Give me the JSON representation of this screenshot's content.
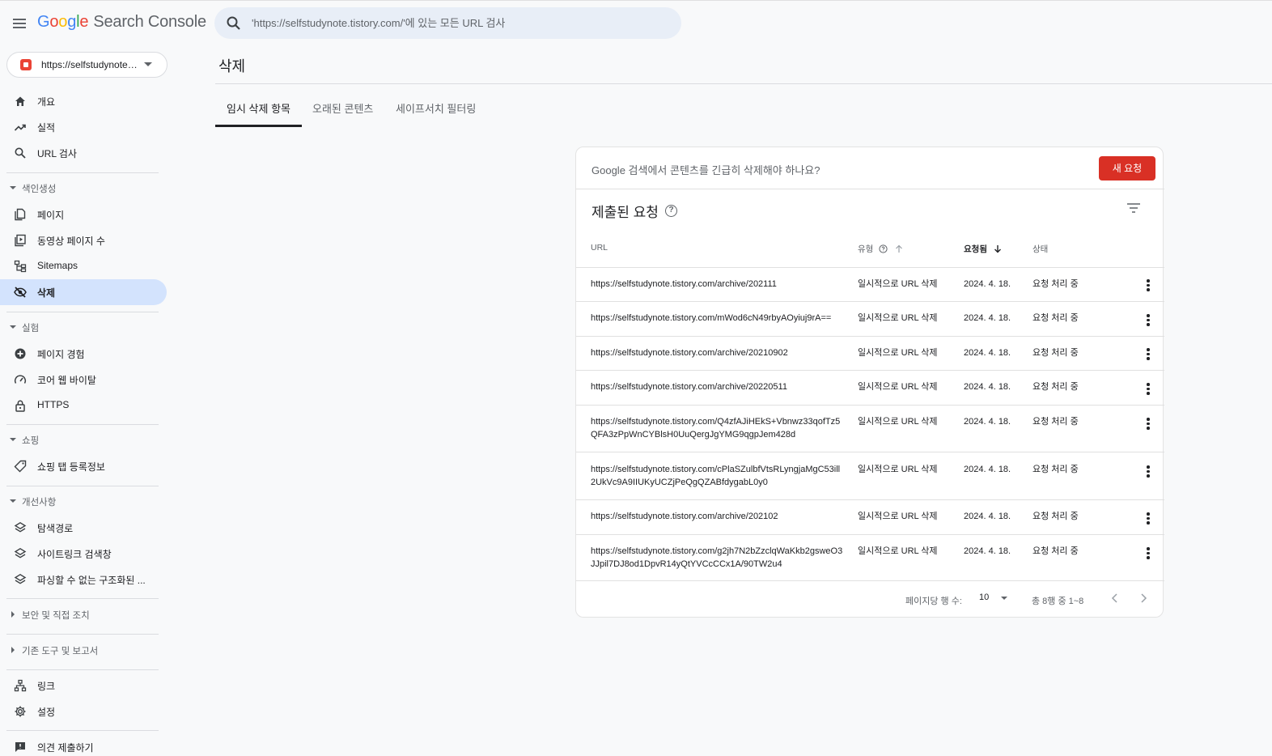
{
  "app": {
    "brand_letters": [
      "G",
      "o",
      "o",
      "g",
      "l",
      "e"
    ],
    "product": "Search Console"
  },
  "search": {
    "placeholder": "'https://selfstudynote.tistory.com/'에 있는 모든 URL 검사"
  },
  "property": {
    "label": "https://selfstudynote.tistory.com/"
  },
  "sidebar": {
    "overview": "개요",
    "performance": "실적",
    "url_inspection": "URL 검사",
    "indexing_section": "색인생성",
    "pages": "페이지",
    "video_pages": "동영상 페이지 수",
    "sitemaps": "Sitemaps",
    "removals": "삭제",
    "experience_section": "실험",
    "page_experience": "페이지 경험",
    "core_web_vitals": "코어 웹 바이탈",
    "https": "HTTPS",
    "shopping_section": "쇼핑",
    "shopping_tab": "쇼핑 탭 등록정보",
    "enhancements_section": "개선사항",
    "breadcrumbs": "탐색경로",
    "sitelinks_searchbox": "사이트링크 검색창",
    "unparsable": "파싱할 수 없는 구조화된 ...",
    "security_section": "보안 및 직접 조치",
    "legacy_section": "기존 도구 및 보고서",
    "links": "링크",
    "settings": "설정",
    "feedback": "의견 제출하기"
  },
  "main": {
    "title": "삭제",
    "tabs": [
      {
        "label": "임시 삭제 항목"
      },
      {
        "label": "오래된 콘텐츠"
      },
      {
        "label": "세이프서치 필터링"
      }
    ],
    "urgent_text": "Google 검색에서 콘텐츠를 긴급히 삭제해야 하나요?",
    "new_request": "새 요청",
    "section_title": "제출된 요청",
    "help_glyph": "?",
    "columns": {
      "url": "URL",
      "type": "유형",
      "requested": "요청됨",
      "status": "상태"
    },
    "rows": [
      {
        "url": "https://selfstudynote.tistory.com/archive/202111",
        "type": "일시적으로 URL 삭제",
        "date": "2024. 4. 18.",
        "status": "요청 처리 중"
      },
      {
        "url": "https://selfstudynote.tistory.com/mWod6cN49rbyAOyiuj9rA==",
        "type": "일시적으로 URL 삭제",
        "date": "2024. 4. 18.",
        "status": "요청 처리 중"
      },
      {
        "url": "https://selfstudynote.tistory.com/archive/20210902",
        "type": "일시적으로 URL 삭제",
        "date": "2024. 4. 18.",
        "status": "요청 처리 중"
      },
      {
        "url": "https://selfstudynote.tistory.com/archive/20220511",
        "type": "일시적으로 URL 삭제",
        "date": "2024. 4. 18.",
        "status": "요청 처리 중"
      },
      {
        "url": "https://selfstudynote.tistory.com/Q4zfAJiHEkS+Vbnwz33qofTz5QFA3zPpWnCYBlsH0UuQergJgYMG9qgpJem428d",
        "type": "일시적으로 URL 삭제",
        "date": "2024. 4. 18.",
        "status": "요청 처리 중"
      },
      {
        "url": "https://selfstudynote.tistory.com/cPlaSZulbfVtsRLyngjaMgC53ill2UkVc9A9IIUKyUCZjPeQgQZABfdygabL0y0",
        "type": "일시적으로 URL 삭제",
        "date": "2024. 4. 18.",
        "status": "요청 처리 중"
      },
      {
        "url": "https://selfstudynote.tistory.com/archive/202102",
        "type": "일시적으로 URL 삭제",
        "date": "2024. 4. 18.",
        "status": "요청 처리 중"
      },
      {
        "url": "https://selfstudynote.tistory.com/g2jh7N2bZzclqWaKkb2gsweO3JJpil7DJ8od1DpvR14yQtYVCcCCx1A/90TW2u4",
        "type": "일시적으로 URL 삭제",
        "date": "2024. 4. 18.",
        "status": "요청 처리 중"
      }
    ],
    "pager": {
      "rows_label": "페이지당 행 수:",
      "rows_value": "10",
      "range": "총 8행 중 1~8"
    }
  },
  "colors": {
    "accent": "#d93025",
    "active_nav": "#d3e3fd",
    "search_bg": "#e8eef7"
  }
}
